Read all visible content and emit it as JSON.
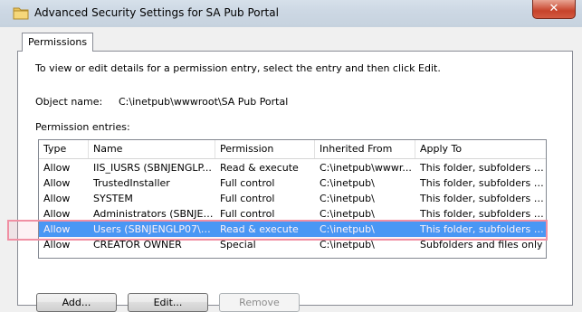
{
  "window": {
    "title": "Advanced Security Settings for SA Pub Portal",
    "close_label": "✕"
  },
  "tabs": [
    {
      "label": "Permissions"
    }
  ],
  "permissions": {
    "intro": "To view or edit details for a permission entry, select the entry and then click Edit.",
    "object_name_label": "Object name:",
    "object_name_value": "C:\\inetpub\\wwwroot\\SA Pub Portal",
    "entries_label": "Permission entries:",
    "columns": [
      "Type",
      "Name",
      "Permission",
      "Inherited From",
      "Apply To"
    ],
    "rows": [
      {
        "type": "Allow",
        "name": "IIS_IUSRS (SBNJENGLP...",
        "permission": "Read & execute",
        "inherited": "C:\\inetpub\\wwwr...",
        "apply": "This folder, subfolders a..."
      },
      {
        "type": "Allow",
        "name": "TrustedInstaller",
        "permission": "Full control",
        "inherited": "C:\\inetpub\\",
        "apply": "This folder, subfolders a..."
      },
      {
        "type": "Allow",
        "name": "SYSTEM",
        "permission": "Full control",
        "inherited": "C:\\inetpub\\",
        "apply": "This folder, subfolders a..."
      },
      {
        "type": "Allow",
        "name": "Administrators (SBNJEN...",
        "permission": "Full control",
        "inherited": "C:\\inetpub\\",
        "apply": "This folder, subfolders a..."
      },
      {
        "type": "Allow",
        "name": "Users (SBNJENGLP07\\U...",
        "permission": "Read & execute",
        "inherited": "C:\\inetpub\\",
        "apply": "This folder, subfolders a..."
      },
      {
        "type": "Allow",
        "name": "CREATOR OWNER",
        "permission": "Special",
        "inherited": "C:\\inetpub\\",
        "apply": "Subfolders and files only"
      }
    ],
    "selected_row": 4,
    "buttons": {
      "add": "Add...",
      "edit": "Edit...",
      "remove": "Remove"
    }
  },
  "colors": {
    "selection": "#3399ff",
    "highlight_outline": "#f08fa3"
  }
}
